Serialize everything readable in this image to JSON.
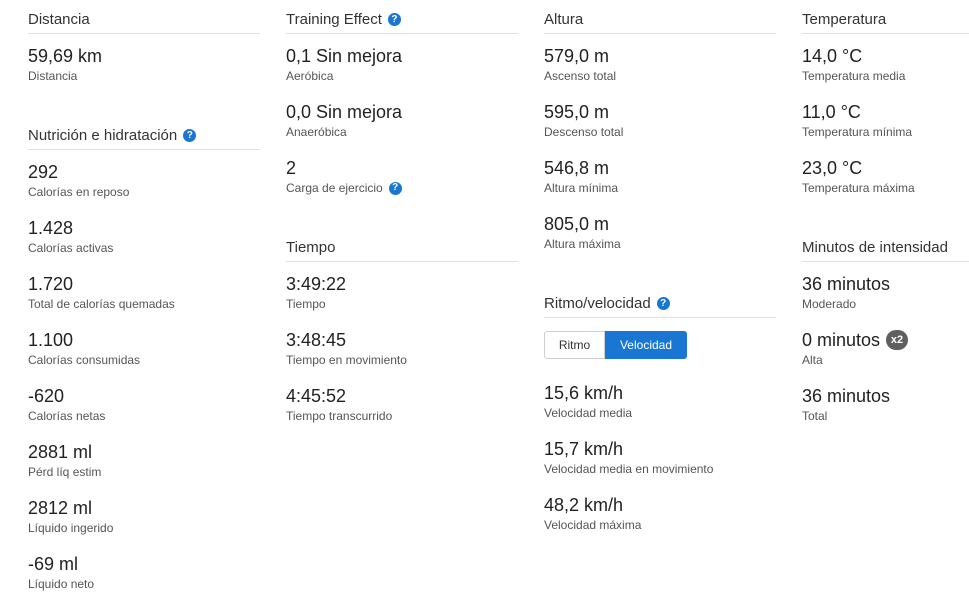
{
  "distancia": {
    "title": "Distancia",
    "stats": [
      {
        "value": "59,69 km",
        "label": "Distancia"
      }
    ]
  },
  "nutricion": {
    "title": "Nutrición e hidratación",
    "stats": [
      {
        "value": "292",
        "label": "Calorías en reposo"
      },
      {
        "value": "1.428",
        "label": "Calorías activas"
      },
      {
        "value": "1.720",
        "label": "Total de calorías quemadas"
      },
      {
        "value": "1.100",
        "label": "Calorías consumidas"
      },
      {
        "value": "-620",
        "label": "Calorías netas"
      },
      {
        "value": "2881 ml",
        "label": "Pérd líq estim"
      },
      {
        "value": "2812 ml",
        "label": "Líquido ingerido"
      },
      {
        "value": "-69 ml",
        "label": "Líquido neto"
      }
    ]
  },
  "training": {
    "title": "Training Effect",
    "stats": [
      {
        "value": "0,1 Sin mejora",
        "label": "Aeróbica"
      },
      {
        "value": "0,0 Sin mejora",
        "label": "Anaeróbica"
      },
      {
        "value": "2",
        "label": "Carga de ejercicio"
      }
    ]
  },
  "tiempo": {
    "title": "Tiempo",
    "stats": [
      {
        "value": "3:49:22",
        "label": "Tiempo"
      },
      {
        "value": "3:48:45",
        "label": "Tiempo en movimiento"
      },
      {
        "value": "4:45:52",
        "label": "Tiempo transcurrido"
      }
    ]
  },
  "altura": {
    "title": "Altura",
    "stats": [
      {
        "value": "579,0 m",
        "label": "Ascenso total"
      },
      {
        "value": "595,0 m",
        "label": "Descenso total"
      },
      {
        "value": "546,8 m",
        "label": "Altura mínima"
      },
      {
        "value": "805,0 m",
        "label": "Altura máxima"
      }
    ]
  },
  "ritmo": {
    "title": "Ritmo/velocidad",
    "toggle": {
      "option1": "Ritmo",
      "option2": "Velocidad",
      "selected": "Velocidad"
    },
    "stats": [
      {
        "value": "15,6 km/h",
        "label": "Velocidad media"
      },
      {
        "value": "15,7 km/h",
        "label": "Velocidad media en movimiento"
      },
      {
        "value": "48,2 km/h",
        "label": "Velocidad máxima"
      }
    ]
  },
  "temperatura": {
    "title": "Temperatura",
    "stats": [
      {
        "value": "14,0 °C",
        "label": "Temperatura media"
      },
      {
        "value": "11,0 °C",
        "label": "Temperatura mínima"
      },
      {
        "value": "23,0 °C",
        "label": "Temperatura máxima"
      }
    ]
  },
  "intensidad": {
    "title": "Minutos de intensidad",
    "stats": [
      {
        "value": "36 minutos",
        "label": "Moderado"
      },
      {
        "value": "0 minutos",
        "label": "Alta",
        "badge": "x2"
      },
      {
        "value": "36 minutos",
        "label": "Total"
      }
    ]
  },
  "help_glyph": "?",
  "colors": {
    "accent": "#1976d2",
    "badge": "#5f5f5f",
    "divider": "#e0e0e0"
  }
}
